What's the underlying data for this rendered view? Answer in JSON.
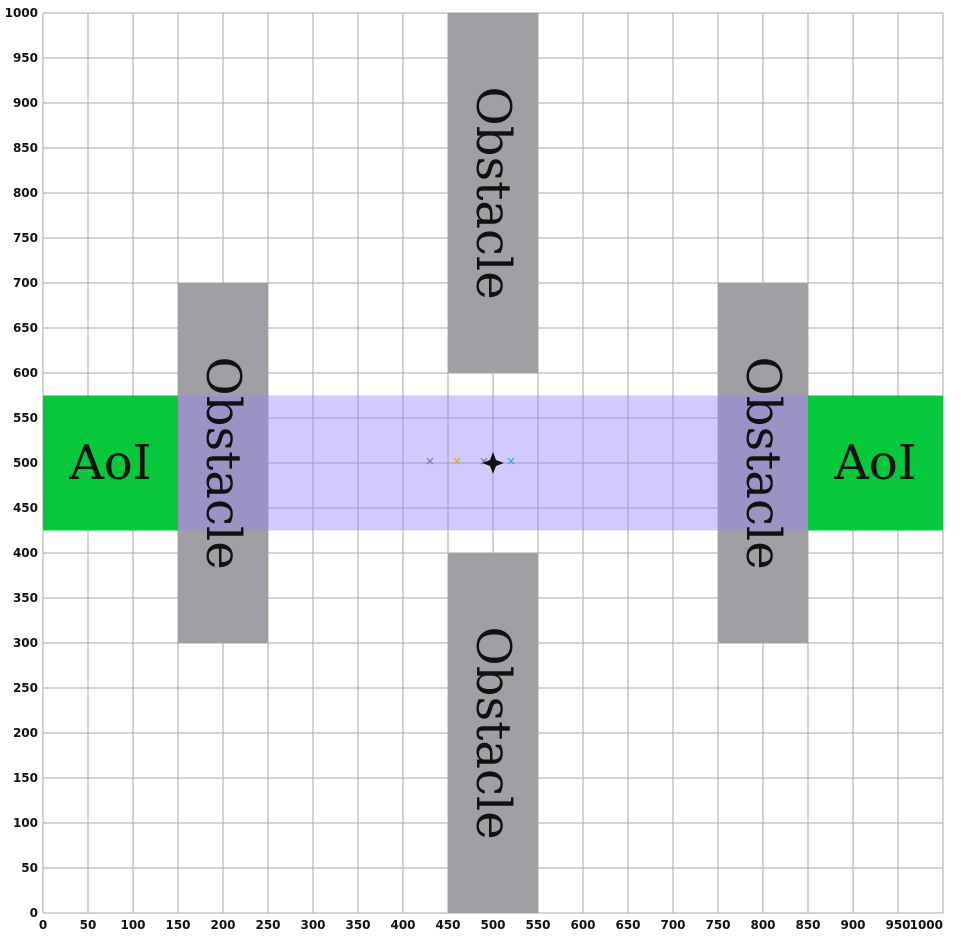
{
  "axes": {
    "x_ticks": [
      0,
      50,
      100,
      150,
      200,
      250,
      300,
      350,
      400,
      450,
      500,
      550,
      600,
      650,
      700,
      750,
      800,
      850,
      900,
      950,
      1000
    ],
    "y_ticks": [
      0,
      50,
      100,
      150,
      200,
      250,
      300,
      350,
      400,
      450,
      500,
      550,
      600,
      650,
      700,
      750,
      800,
      850,
      900,
      950,
      1000
    ],
    "xlim": [
      0,
      1000
    ],
    "ylim": [
      0,
      1000
    ],
    "grid": true
  },
  "colors": {
    "obstacle": "#a09fa4",
    "aoi": "#07c73a",
    "band": "#cfc9fb",
    "band_overlap": "#8882be",
    "grid": "#a8a8a8",
    "marker_blue": "#3fa0e6",
    "marker_orange": "#e8a23c",
    "marker_purple": "#8a72c8"
  },
  "regions": [
    {
      "id": "obstacle-top",
      "kind": "obstacle",
      "label": "Obstacle",
      "x0": 450,
      "x1": 550,
      "y0": 600,
      "y1": 1000
    },
    {
      "id": "obstacle-bottom",
      "kind": "obstacle",
      "label": "Obstacle",
      "x0": 450,
      "x1": 550,
      "y0": 0,
      "y1": 400
    },
    {
      "id": "obstacle-left",
      "kind": "obstacle",
      "label": "Obstacle",
      "x0": 150,
      "x1": 250,
      "y0": 300,
      "y1": 700
    },
    {
      "id": "obstacle-right",
      "kind": "obstacle",
      "label": "Obstacle",
      "x0": 750,
      "x1": 850,
      "y0": 300,
      "y1": 700
    },
    {
      "id": "aoi-left",
      "kind": "aoi",
      "label": "AoI",
      "x0": 0,
      "x1": 150,
      "y0": 425,
      "y1": 575
    },
    {
      "id": "aoi-right",
      "kind": "aoi",
      "label": "AoI",
      "x0": 850,
      "x1": 1000,
      "y0": 425,
      "y1": 575
    }
  ],
  "band": {
    "x0": 150,
    "x1": 850,
    "y0": 425,
    "y1": 575
  },
  "markers": [
    {
      "x": 430,
      "y": 502,
      "color": "marker_purple"
    },
    {
      "x": 460,
      "y": 502,
      "color": "marker_orange"
    },
    {
      "x": 490,
      "y": 502,
      "color": "marker_purple"
    },
    {
      "x": 520,
      "y": 502,
      "color": "marker_blue"
    }
  ],
  "center_marker": {
    "x": 500,
    "y": 500
  }
}
